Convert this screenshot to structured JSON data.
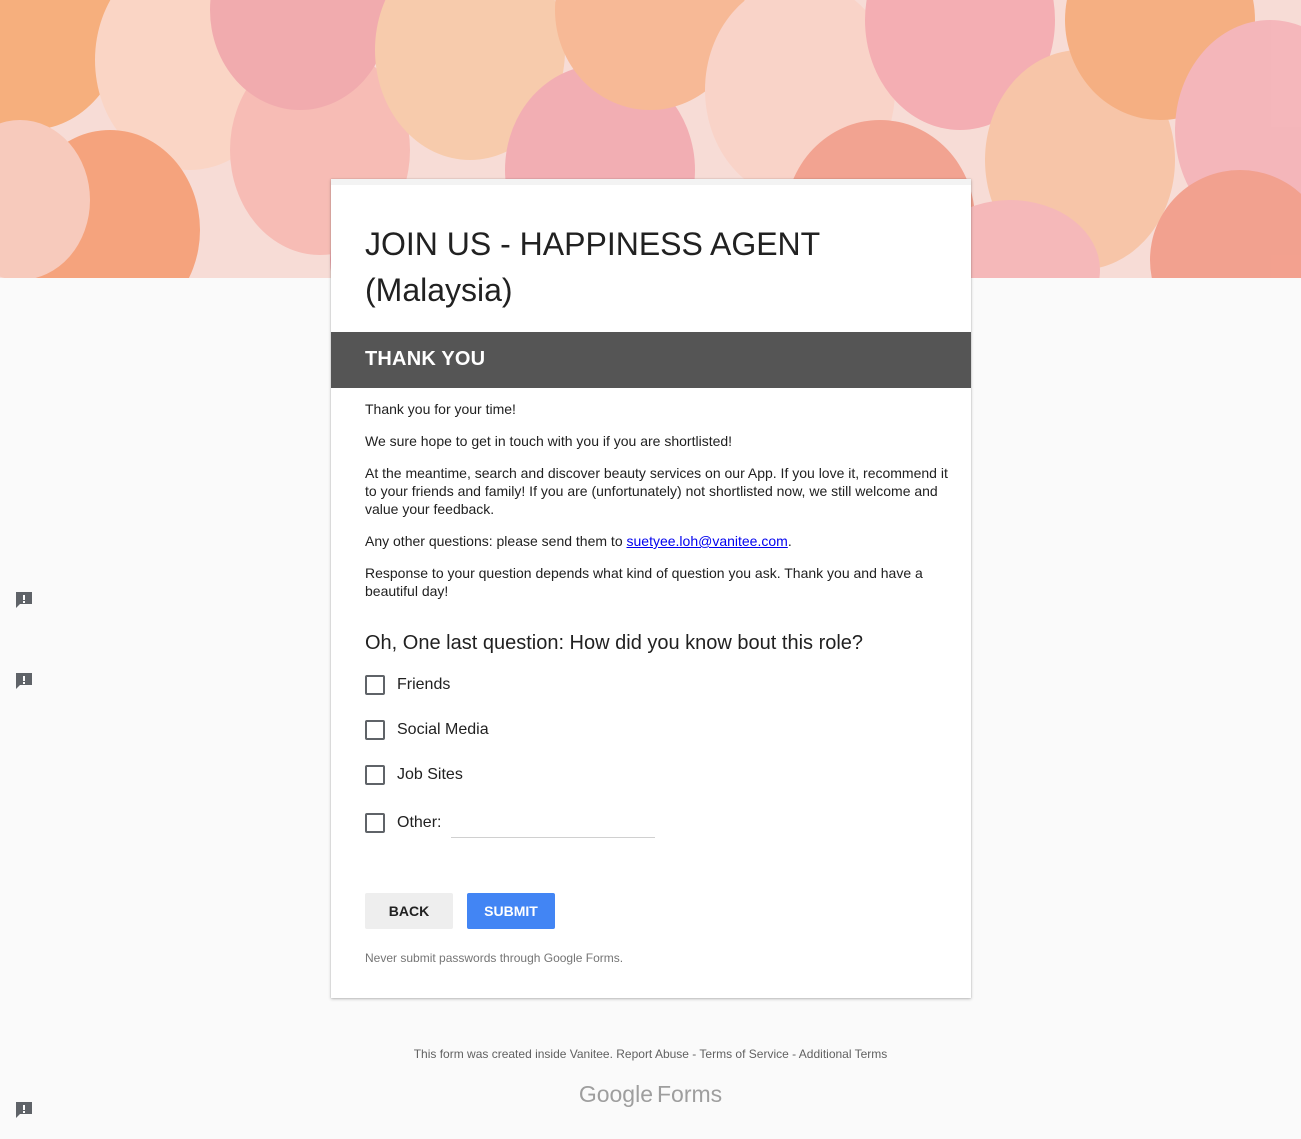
{
  "form": {
    "title": "JOIN US - HAPPINESS AGENT (Malaysia)",
    "section_title": "THANK YOU",
    "description": {
      "p1": "Thank you for your time!",
      "p2": "We sure hope to get in touch with you if you are shortlisted!",
      "p3": "At the meantime, search and discover beauty services on our App. If you love it, recommend it to your friends and family! If you are (unfortunately) not shortlisted now, we still welcome and value your feedback.",
      "p4_prefix": "Any other questions: please send them to ",
      "p4_email": "suetyee.loh@vanitee.com",
      "p4_suffix": ".",
      "p5": "Response to your question depends what kind of question you ask. Thank you and have a beautiful day!"
    },
    "question": {
      "title": "Oh, One last question: How did you know bout this role?",
      "options": [
        "Friends",
        "Social Media",
        "Job Sites"
      ],
      "other_label": "Other:",
      "other_value": ""
    },
    "buttons": {
      "back": "BACK",
      "submit": "SUBMIT"
    },
    "warning": "Never submit passwords through Google Forms."
  },
  "footer": {
    "created_text": "This form was created inside Vanitee.",
    "report_abuse": "Report Abuse",
    "sep": " - ",
    "terms": "Terms of Service",
    "additional": "Additional Terms",
    "brand_google": "Google",
    "brand_forms": "Forms"
  },
  "colors": {
    "section_header": "#555555",
    "submit_button": "#4285f4",
    "link": "#0000ee"
  },
  "icons": {
    "feedback": "report-feedback-icon"
  }
}
